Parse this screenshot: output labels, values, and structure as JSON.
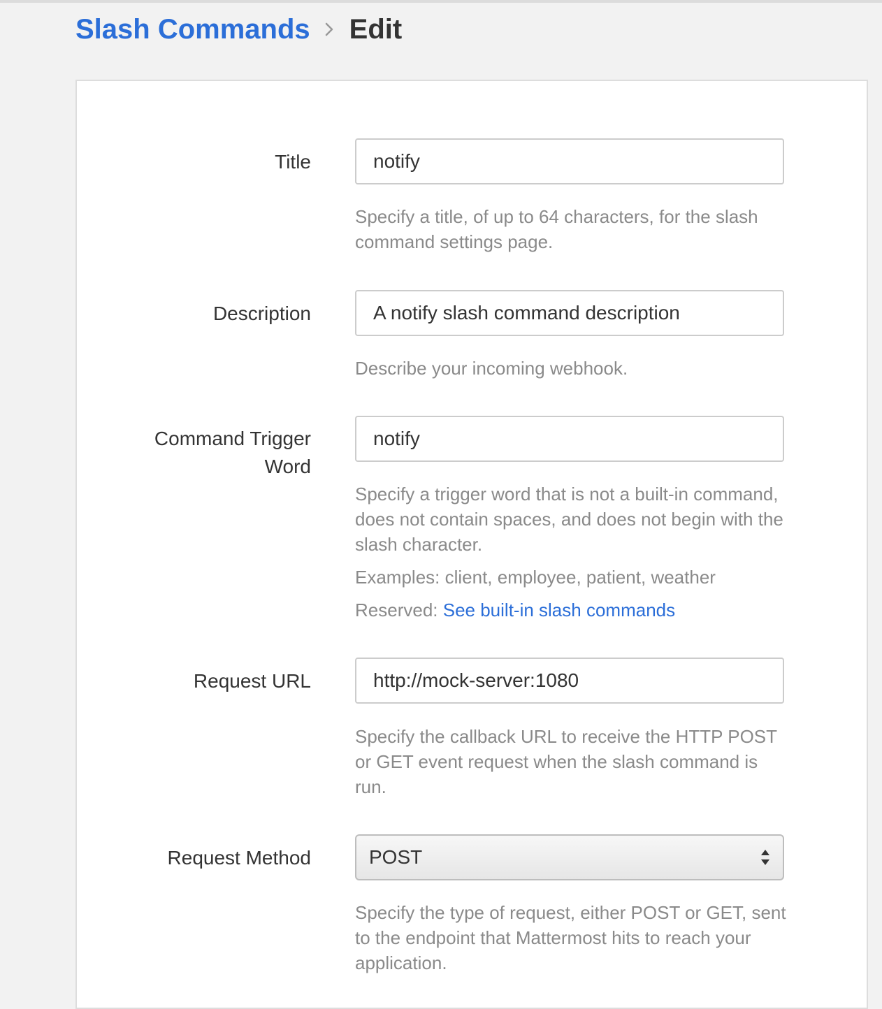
{
  "breadcrumb": {
    "parent": "Slash Commands",
    "separator_icon": "chevron-right-icon",
    "current": "Edit"
  },
  "colors": {
    "link": "#2b6ed8",
    "text": "#333333",
    "help_text": "#8a8a8a",
    "page_bg": "#f2f2f2",
    "panel_bg": "#ffffff"
  },
  "form": {
    "title": {
      "label": "Title",
      "value": "notify",
      "help": "Specify a title, of up to 64 characters, for the slash command settings page."
    },
    "description": {
      "label": "Description",
      "value": "A notify slash command description",
      "help": "Describe your incoming webhook."
    },
    "trigger": {
      "label_line1": "Command Trigger",
      "label_line2": "Word",
      "value": "notify",
      "help": "Specify a trigger word that is not a built-in command, does not contain spaces, and does not begin with the slash character.",
      "examples": "Examples: client, employee, patient, weather",
      "reserved_prefix": "Reserved: ",
      "reserved_link": "See built-in slash commands"
    },
    "request_url": {
      "label": "Request URL",
      "value": "http://mock-server:1080",
      "help": "Specify the callback URL to receive the HTTP POST or GET event request when the slash command is run."
    },
    "request_method": {
      "label": "Request Method",
      "selected": "POST",
      "help": "Specify the type of request, either POST or GET, sent to the endpoint that Mattermost hits to reach your application."
    }
  }
}
